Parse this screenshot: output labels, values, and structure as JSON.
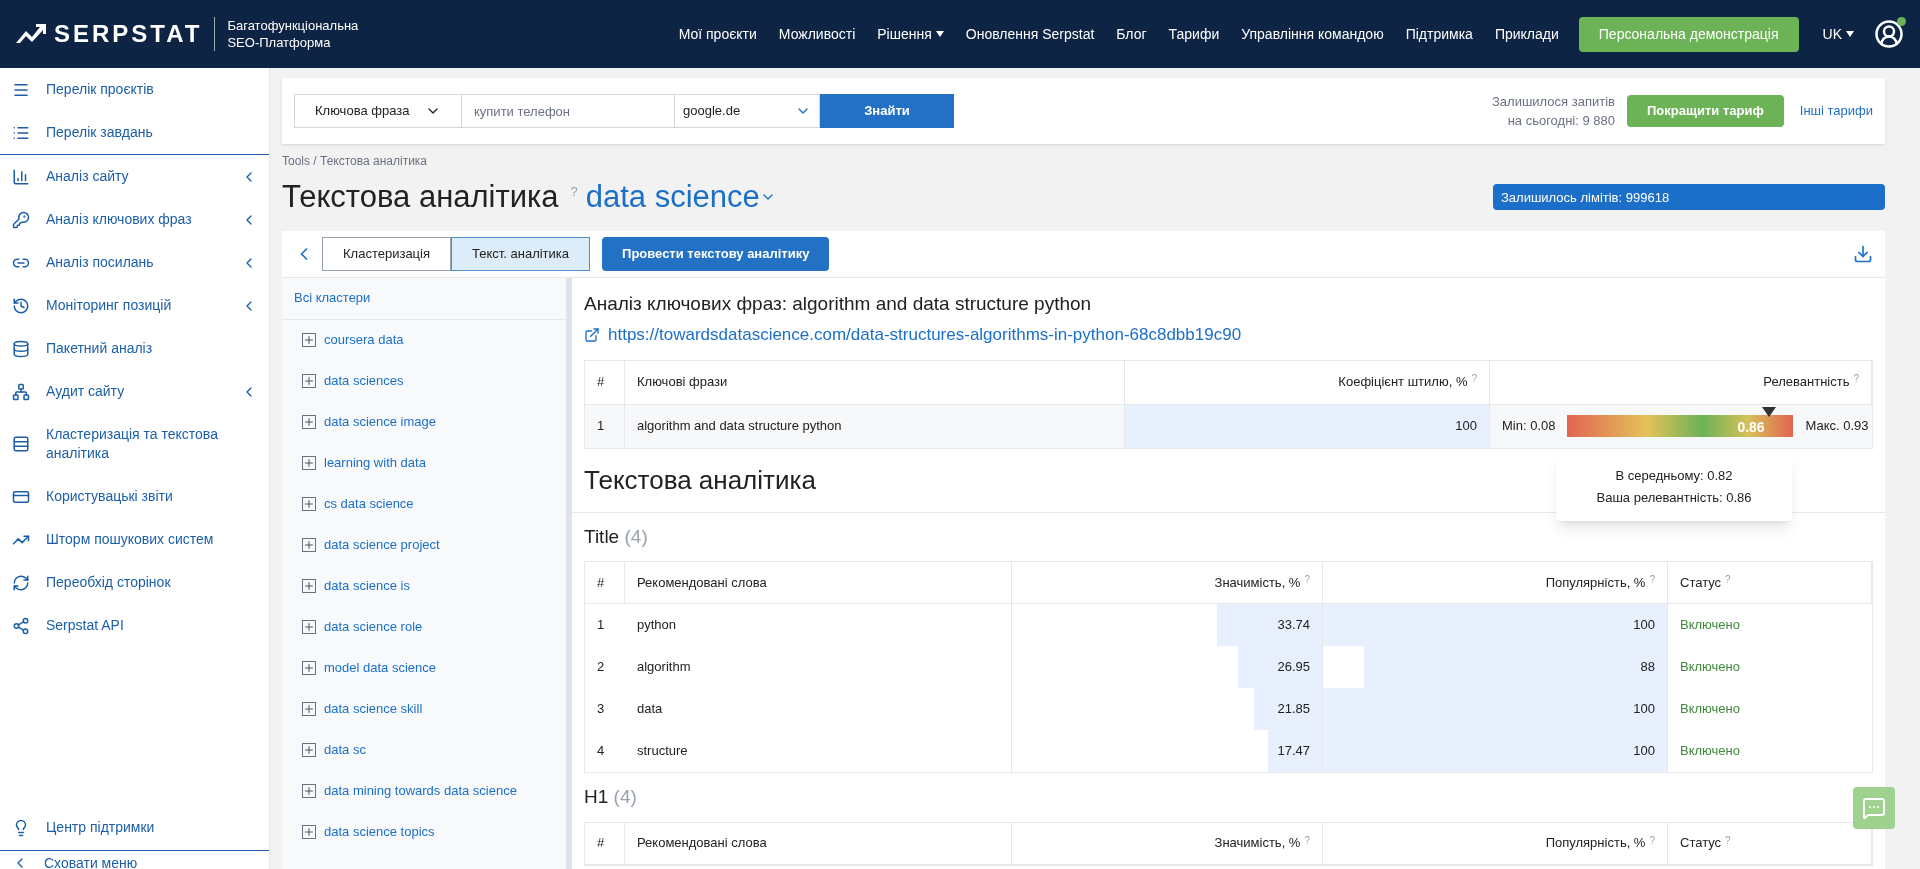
{
  "header": {
    "logo": "SERPSTAT",
    "tagline": [
      "Багатофункціональна",
      "SEO-Платформа"
    ],
    "nav": [
      {
        "label": "Мої проєкти",
        "dropdown": false
      },
      {
        "label": "Можливості",
        "dropdown": false
      },
      {
        "label": "Рішення",
        "dropdown": true
      },
      {
        "label": "Оновлення Serpstat",
        "dropdown": false
      },
      {
        "label": "Блог",
        "dropdown": false
      },
      {
        "label": "Тарифи",
        "dropdown": false
      },
      {
        "label": "Управління командою",
        "dropdown": false
      },
      {
        "label": "Підтримка",
        "dropdown": false
      },
      {
        "label": "Приклади",
        "dropdown": false
      }
    ],
    "demo_button": "Персональна демонстрація",
    "language": "UK",
    "online": true
  },
  "sidebar": {
    "items": [
      {
        "label": "Перелік проєктів",
        "expandable": false,
        "divider_after": false
      },
      {
        "label": "Перелік завдань",
        "expandable": false,
        "divider_after": true
      },
      {
        "label": "Аналіз сайту",
        "expandable": true,
        "divider_after": false
      },
      {
        "label": "Аналіз ключових фраз",
        "expandable": true,
        "divider_after": false
      },
      {
        "label": "Аналіз посилань",
        "expandable": true,
        "divider_after": false
      },
      {
        "label": "Моніторинг позицій",
        "expandable": true,
        "divider_after": false
      },
      {
        "label": "Пакетний аналіз",
        "expandable": false,
        "divider_after": false
      },
      {
        "label": "Аудит сайту",
        "expandable": true,
        "divider_after": false
      },
      {
        "label": "Кластеризація та текстова аналітика",
        "expandable": false,
        "divider_after": false
      },
      {
        "label": "Користувацькі звіти",
        "expandable": false,
        "divider_after": false
      },
      {
        "label": "Шторм пошукових систем",
        "expandable": false,
        "divider_after": false
      },
      {
        "label": "Переобхід сторінок",
        "expandable": false,
        "divider_after": false
      },
      {
        "label": "Serpstat API",
        "expandable": false,
        "divider_after": false
      }
    ],
    "support": "Центр підтримки",
    "hide_menu": "Сховати меню"
  },
  "search": {
    "mode": "Ключова фраза",
    "placeholder": "купити телефон",
    "engine": "google.de",
    "button": "Знайти",
    "remaining": [
      "Залишилося запитів",
      "на сьогодні: 9 880"
    ],
    "upgrade": "Покращити тариф",
    "other_plans": "Інші тарифи"
  },
  "breadcrumb": "Tools / Текстова аналітика",
  "title": "Текстова аналітика",
  "title_help": "?",
  "project": "data science",
  "limits": "Залишилось лімітів: 999618",
  "tabs": [
    {
      "label": "Кластеризація",
      "selected": false
    },
    {
      "label": "Текст. аналітика",
      "selected": true
    }
  ],
  "run_button": "Провести текстову аналітику",
  "clusters": {
    "all": "Всі кластери",
    "items": [
      "coursera data",
      "data sciences",
      "data science image",
      "learning with data",
      "cs data science",
      "data science project",
      "data science is",
      "data science role",
      "model data science",
      "data science skill",
      "data sc",
      "data mining towards data science",
      "data science topics"
    ]
  },
  "analysis": {
    "heading": "Аналіз ключових фраз: algorithm and data structure python",
    "url": "https://towardsdatascience.com/data-structures-algorithms-in-python-68c8dbb19c90",
    "columns": [
      {
        "label": "#"
      },
      {
        "label": "Ключові фрази"
      },
      {
        "label": "Коефіцієнт штилю, %",
        "help": "?"
      },
      {
        "label": "Релевантність",
        "help": "?"
      }
    ],
    "rows": [
      {
        "n": "1",
        "phrase": "algorithm and data structure python",
        "coef": "100",
        "min": "Min: 0.08",
        "max": "Макс. 0.93",
        "value": "0.86",
        "level": 0.89
      }
    ],
    "tooltip": [
      "В середньому: 0.82",
      "Ваша релевантність: 0.86"
    ]
  },
  "text_heading": "Текстова аналітика",
  "sections": [
    {
      "title": "Title",
      "count": "(4)",
      "columns": [
        {
          "label": "#"
        },
        {
          "label": "Рекомендовані слова"
        },
        {
          "label": "Значимість, %",
          "help": "?"
        },
        {
          "label": "Популярність, %",
          "help": "?"
        },
        {
          "label": "Статус",
          "help": "?"
        }
      ],
      "rows": [
        {
          "n": "1",
          "word": "python",
          "significance": {
            "value": "33.74",
            "level": 0.3374
          },
          "popularity": {
            "value": "100",
            "level": 1
          },
          "status": "Включено"
        },
        {
          "n": "2",
          "word": "algorithm",
          "significance": {
            "value": "26.95",
            "level": 0.2695
          },
          "popularity": {
            "value": "88",
            "level": 0.88
          },
          "status": "Включено"
        },
        {
          "n": "3",
          "word": "data",
          "significance": {
            "value": "21.85",
            "level": 0.2185
          },
          "popularity": {
            "value": "100",
            "level": 1
          },
          "status": "Включено"
        },
        {
          "n": "4",
          "word": "structure",
          "significance": {
            "value": "17.47",
            "level": 0.1747
          },
          "popularity": {
            "value": "100",
            "level": 1
          },
          "status": "Включено"
        }
      ]
    },
    {
      "title": "H1",
      "count": "(4)",
      "columns": [
        {
          "label": "#"
        },
        {
          "label": "Рекомендовані слова"
        },
        {
          "label": "Значимість, %",
          "help": "?"
        },
        {
          "label": "Популярність, %",
          "help": "?"
        },
        {
          "label": "Статус",
          "help": "?"
        }
      ]
    }
  ]
}
